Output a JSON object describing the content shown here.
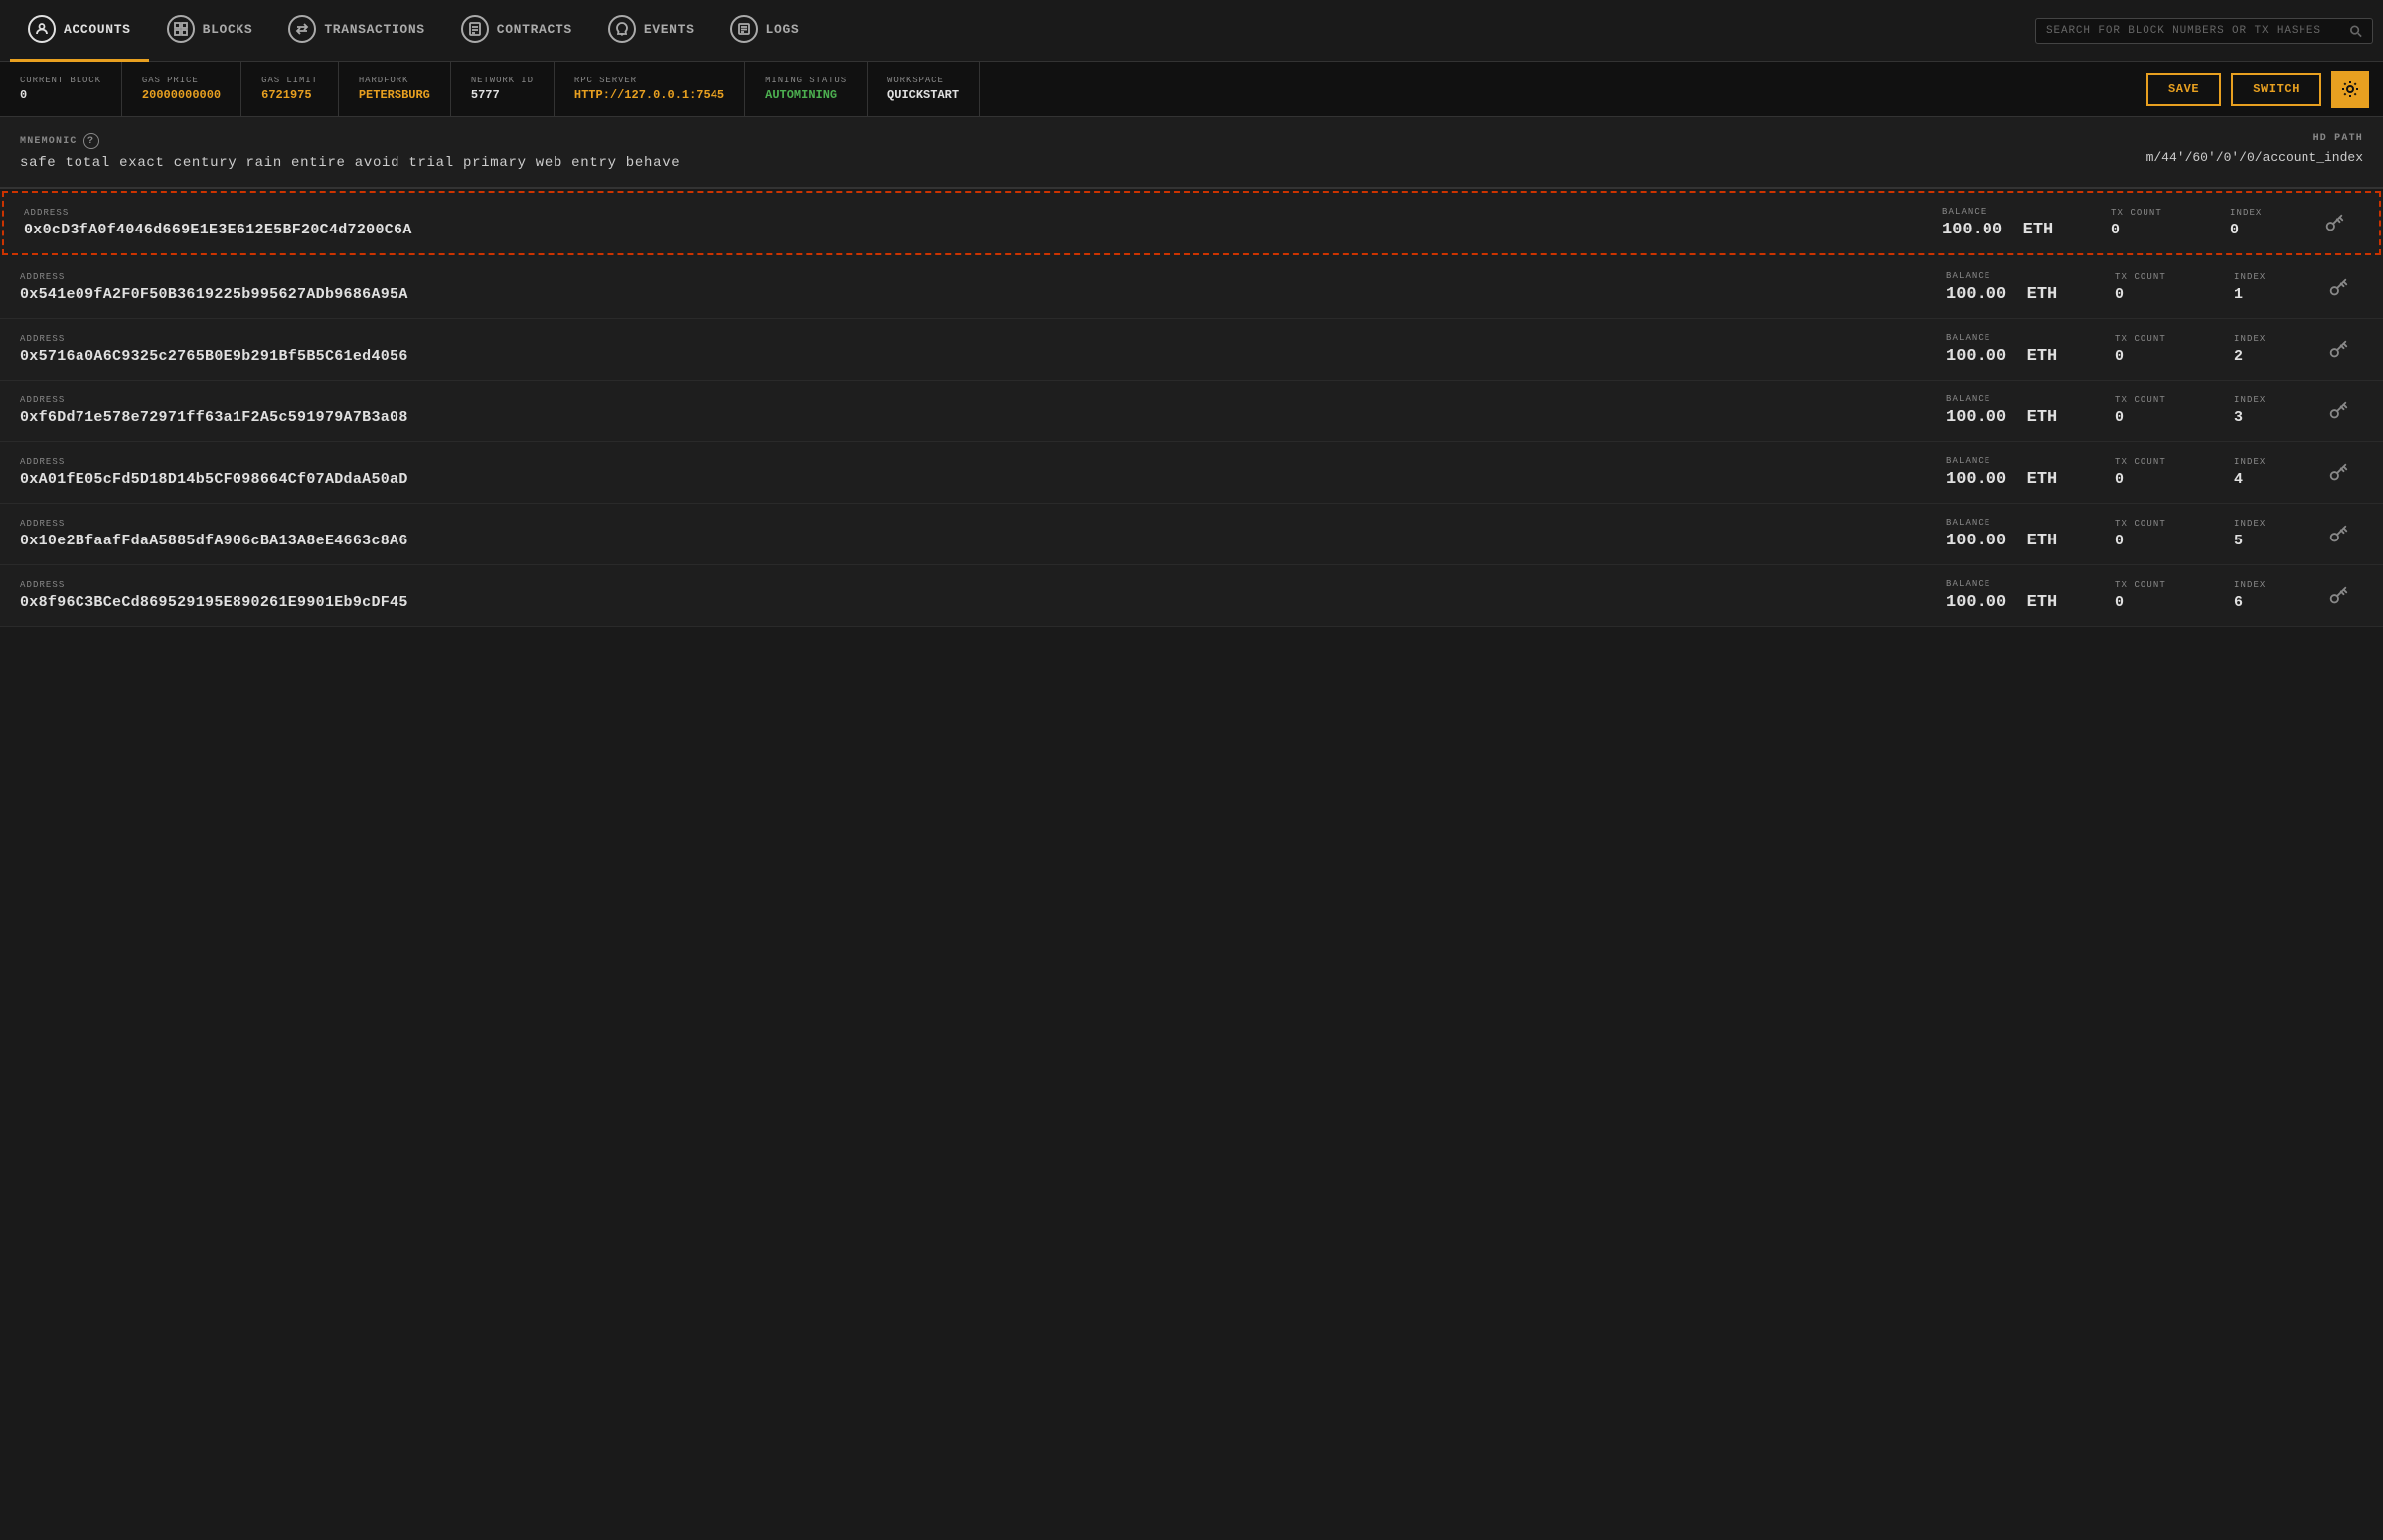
{
  "nav": {
    "items": [
      {
        "id": "accounts",
        "label": "ACCOUNTS",
        "icon": "person",
        "active": true
      },
      {
        "id": "blocks",
        "label": "BLOCKS",
        "icon": "grid",
        "active": false
      },
      {
        "id": "transactions",
        "label": "TRANSACTIONS",
        "icon": "arrows",
        "active": false
      },
      {
        "id": "contracts",
        "label": "CONTRACTS",
        "icon": "doc",
        "active": false
      },
      {
        "id": "events",
        "label": "EVENTS",
        "icon": "bell",
        "active": false
      },
      {
        "id": "logs",
        "label": "LOGS",
        "icon": "log",
        "active": false
      }
    ],
    "search_placeholder": "SEARCH FOR BLOCK NUMBERS OR TX HASHES"
  },
  "statusbar": {
    "current_block_label": "CURRENT BLOCK",
    "current_block_value": "0",
    "gas_price_label": "GAS PRICE",
    "gas_price_value": "20000000000",
    "gas_limit_label": "GAS LIMIT",
    "gas_limit_value": "6721975",
    "hardfork_label": "HARDFORK",
    "hardfork_value": "PETERSBURG",
    "network_id_label": "NETWORK ID",
    "network_id_value": "5777",
    "rpc_server_label": "RPC SERVER",
    "rpc_server_value": "HTTP://127.0.0.1:7545",
    "mining_status_label": "MINING STATUS",
    "mining_status_value": "AUTOMINING",
    "workspace_label": "WORKSPACE",
    "workspace_value": "QUICKSTART",
    "save_label": "SAVE",
    "switch_label": "SWITCH"
  },
  "mnemonic": {
    "label": "MNEMONIC",
    "words": "safe  total  exact  century  rain  entire  avoid  trial  primary  web  entry  behave",
    "hdpath_label": "HD PATH",
    "hdpath_value": "m/44'/60'/0'/0/account_index"
  },
  "accounts": [
    {
      "address": "0x0cD3fA0f4046d669E1E3E612E5BF20C4d7200C6A",
      "balance": "100.00",
      "currency": "ETH",
      "tx_count": "0",
      "index": "0",
      "selected": true
    },
    {
      "address": "0x541e09fA2F0F50B3619225b995627ADb9686A95A",
      "balance": "100.00",
      "currency": "ETH",
      "tx_count": "0",
      "index": "1",
      "selected": false
    },
    {
      "address": "0x5716a0A6C9325c2765B0E9b291Bf5B5C61ed4056",
      "balance": "100.00",
      "currency": "ETH",
      "tx_count": "0",
      "index": "2",
      "selected": false
    },
    {
      "address": "0xf6Dd71e578e72971ff63a1F2A5c591979A7B3a08",
      "balance": "100.00",
      "currency": "ETH",
      "tx_count": "0",
      "index": "3",
      "selected": false
    },
    {
      "address": "0xA01fE05cFd5D18D14b5CF098664Cf07ADdaA50aD",
      "balance": "100.00",
      "currency": "ETH",
      "tx_count": "0",
      "index": "4",
      "selected": false
    },
    {
      "address": "0x10e2BfaafFdaA5885dfA906cBA13A8eE4663c8A6",
      "balance": "100.00",
      "currency": "ETH",
      "tx_count": "0",
      "index": "5",
      "selected": false
    },
    {
      "address": "0x8f96C3BCeCd869529195E890261E9901Eb9cDF45",
      "balance": "100.00",
      "currency": "ETH",
      "tx_count": "0",
      "index": "6",
      "selected": false
    }
  ]
}
